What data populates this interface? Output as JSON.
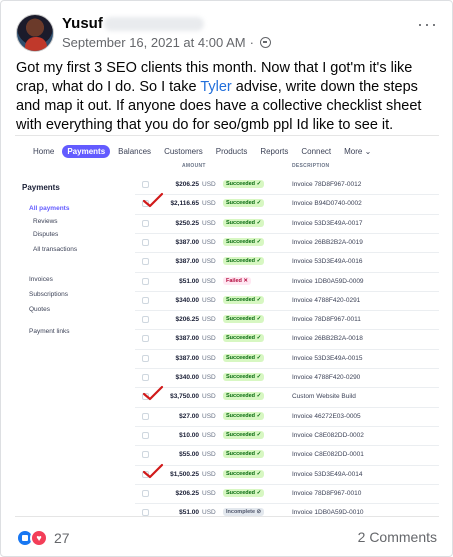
{
  "post": {
    "author": "Yusuf",
    "timestamp": "September 16, 2021 at 4:00 AM",
    "privacy_icon": "globe-icon",
    "text_before": "Got my first 3 SEO clients this month. Now that I got'm it's like crap, what do I do. So I take ",
    "tagged": "Tyler",
    "text_after": " advise, write down the steps and map it out. If anyone does have a collective checklist sheet with everything that you do for seo/gmb ppl Id like to see it."
  },
  "screenshot": {
    "nav": [
      "Home",
      "Payments",
      "Balances",
      "Customers",
      "Products",
      "Reports",
      "Connect",
      "More ⌄"
    ],
    "active_nav": "Payments",
    "col_amount": "AMOUNT",
    "col_description": "DESCRIPTION",
    "sidebar_title": "Payments",
    "sidebar_items": [
      "All payments",
      "Reviews",
      "Disputes",
      "All transactions",
      "Invoices",
      "Subscriptions",
      "Quotes",
      "Payment links"
    ],
    "rows": [
      {
        "amount": "$206.25",
        "currency": "USD",
        "status": "Succeeded ✓",
        "kind": "ok",
        "desc": "Invoice 78D8F967-0012"
      },
      {
        "amount": "$2,116.65",
        "currency": "USD",
        "status": "Succeeded ✓",
        "kind": "ok",
        "desc": "Invoice B94D0740-0002"
      },
      {
        "amount": "$250.25",
        "currency": "USD",
        "status": "Succeeded ✓",
        "kind": "ok",
        "desc": "Invoice 53D3E49A-0017"
      },
      {
        "amount": "$387.00",
        "currency": "USD",
        "status": "Succeeded ✓",
        "kind": "ok",
        "desc": "Invoice 26BB2B2A-0019"
      },
      {
        "amount": "$387.00",
        "currency": "USD",
        "status": "Succeeded ✓",
        "kind": "ok",
        "desc": "Invoice 53D3E49A-0016"
      },
      {
        "amount": "$51.00",
        "currency": "USD",
        "status": "Failed ✕",
        "kind": "failed",
        "desc": "Invoice 1DB0A59D-0009"
      },
      {
        "amount": "$340.00",
        "currency": "USD",
        "status": "Succeeded ✓",
        "kind": "ok",
        "desc": "Invoice 4788F420-0291"
      },
      {
        "amount": "$206.25",
        "currency": "USD",
        "status": "Succeeded ✓",
        "kind": "ok",
        "desc": "Invoice 78D8F967-0011"
      },
      {
        "amount": "$387.00",
        "currency": "USD",
        "status": "Succeeded ✓",
        "kind": "ok",
        "desc": "Invoice 26BB2B2A-0018"
      },
      {
        "amount": "$387.00",
        "currency": "USD",
        "status": "Succeeded ✓",
        "kind": "ok",
        "desc": "Invoice 53D3E49A-0015"
      },
      {
        "amount": "$340.00",
        "currency": "USD",
        "status": "Succeeded ✓",
        "kind": "ok",
        "desc": "Invoice 4788F420-0290"
      },
      {
        "amount": "$3,750.00",
        "currency": "USD",
        "status": "Succeeded ✓",
        "kind": "ok",
        "desc": "Custom Website Build"
      },
      {
        "amount": "$27.00",
        "currency": "USD",
        "status": "Succeeded ✓",
        "kind": "ok",
        "desc": "Invoice 46272E03-0005"
      },
      {
        "amount": "$10.00",
        "currency": "USD",
        "status": "Succeeded ✓",
        "kind": "ok",
        "desc": "Invoice C8E082DD-0002"
      },
      {
        "amount": "$55.00",
        "currency": "USD",
        "status": "Succeeded ✓",
        "kind": "ok",
        "desc": "Invoice C8E082DD-0001"
      },
      {
        "amount": "$1,500.25",
        "currency": "USD",
        "status": "Succeeded ✓",
        "kind": "ok",
        "desc": "Invoice 53D3E49A-0014"
      },
      {
        "amount": "$206.25",
        "currency": "USD",
        "status": "Succeeded ✓",
        "kind": "ok",
        "desc": "Invoice 78D8F967-0010"
      },
      {
        "amount": "$51.00",
        "currency": "USD",
        "status": "Incomplete ⊘",
        "kind": "incomplete",
        "desc": "Invoice 1DB0A59D-0010"
      }
    ],
    "marked_rows": [
      1,
      11,
      15
    ]
  },
  "footer": {
    "reaction_count": "27",
    "comments": "2 Comments",
    "reaction_icons": [
      "like-icon",
      "love-icon"
    ]
  }
}
